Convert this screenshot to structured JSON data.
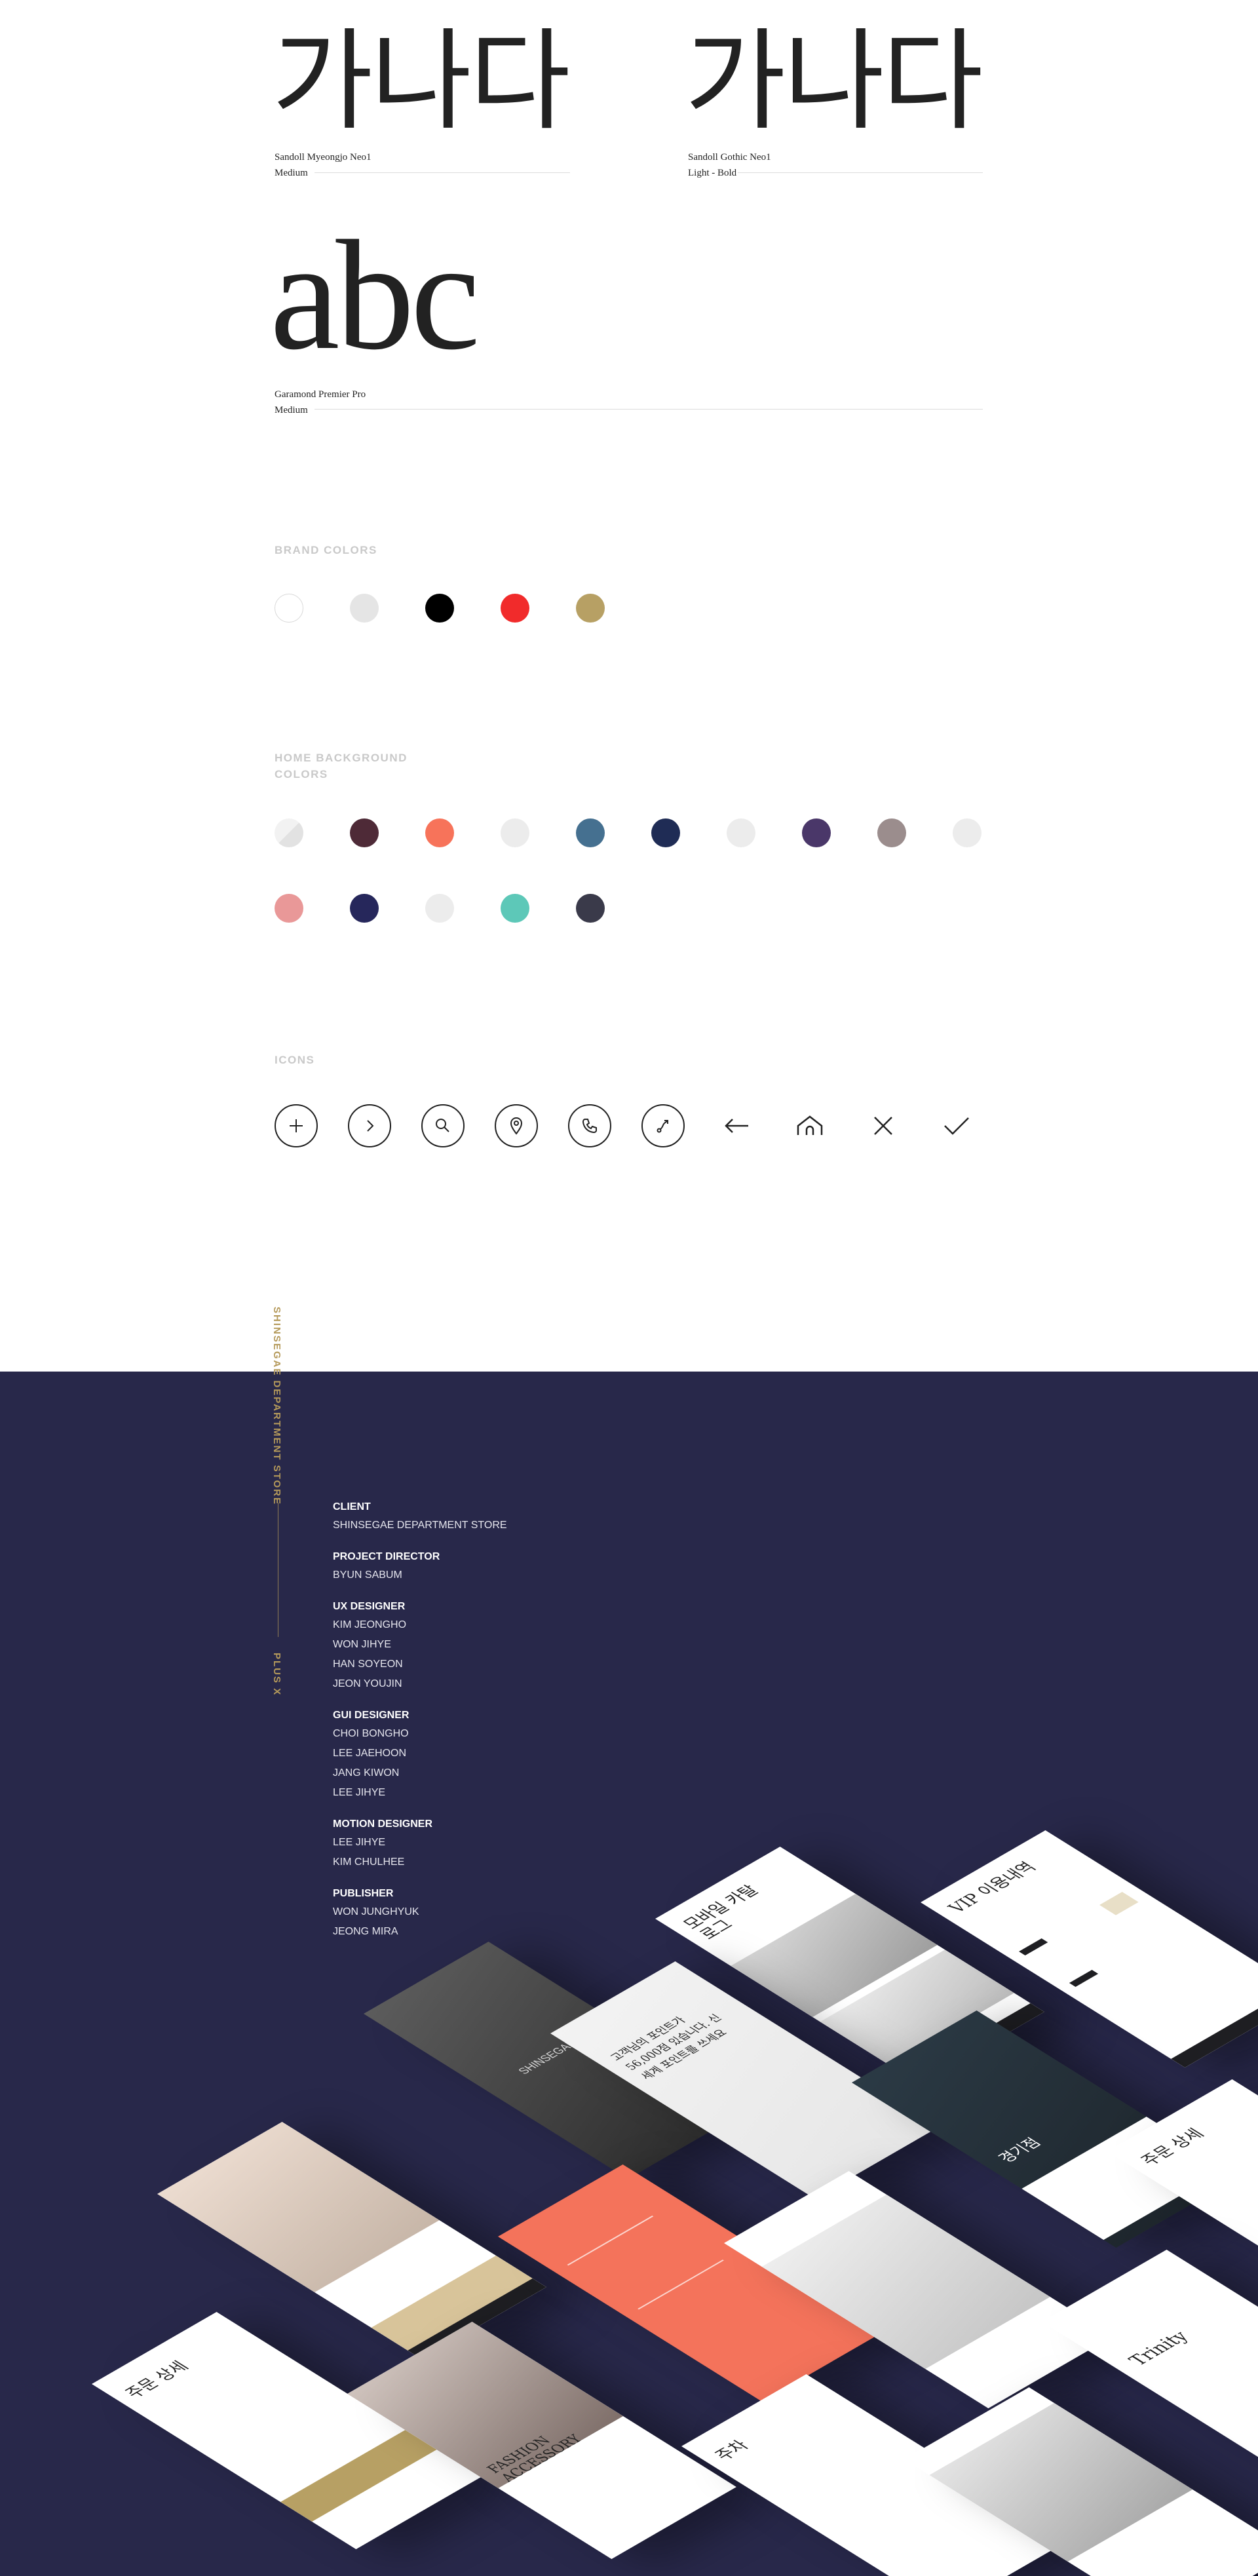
{
  "typography": [
    {
      "sample": "가나다",
      "name": "Sandoll Myeongjo Neo1",
      "weight": "Medium"
    },
    {
      "sample": "가나다",
      "name": "Sandoll Gothic Neo1",
      "weight": "Light - Bold"
    },
    {
      "sample": "abc",
      "name": "Garamond Premier Pro",
      "weight": "Medium"
    }
  ],
  "brand_colors": {
    "title": "BRAND COLORS",
    "colors": [
      "#ffffff",
      "#e5e5e5",
      "#000000",
      "#f12b2b",
      "#b7a064"
    ]
  },
  "home_background_colors": {
    "title_line1": "HOME BACKGROUND",
    "title_line2": "COLORS",
    "row1": [
      "#ececec",
      "#4e2a37",
      "#f7735a",
      "#ececec",
      "#457090",
      "#1f2c55",
      "#ececec",
      "#4a3769",
      "#9b8d8d",
      "#ececec"
    ],
    "row2": [
      "#e99898",
      "#26275b",
      "#ececec",
      "#5dc8b8",
      "#3a3a4a"
    ]
  },
  "icons": {
    "title": "ICONS",
    "items": [
      "plus-icon",
      "chevron-right-icon",
      "search-icon",
      "location-pin-icon",
      "phone-icon",
      "route-icon",
      "arrow-left-icon",
      "home-icon",
      "close-icon",
      "check-icon"
    ]
  },
  "credits": {
    "vertical_store": "SHINSEGAE DEPARTMENT STORE",
    "vertical_agency": "PLUS X",
    "groups": [
      {
        "role": "CLIENT",
        "names": [
          "SHINSEGAE DEPARTMENT STORE"
        ]
      },
      {
        "role": "PROJECT DIRECTOR",
        "names": [
          "BYUN SABUM"
        ]
      },
      {
        "role": "UX DESIGNER",
        "names": [
          "KIM JEONGHO",
          "WON JIHYE",
          "HAN SOYEON",
          "JEON YOUJIN"
        ]
      },
      {
        "role": "GUI DESIGNER",
        "names": [
          "CHOI BONGHO",
          "LEE JAEHOON",
          "JANG KIWON",
          "LEE JIHYE"
        ]
      },
      {
        "role": "MOTION DESIGNER",
        "names": [
          "LEE JIHYE",
          "KIM CHULHEE"
        ]
      },
      {
        "role": "PUBLISHER",
        "names": [
          "WON JUNGHYUK",
          "JEONG MIRA"
        ]
      }
    ]
  },
  "mockups": {
    "splash_logo": "SHINSEGAE",
    "catalog_title": "모바일 카탈로그",
    "vip_title": "VIP 이용내역",
    "order_title": "주문 상세",
    "order_title_2": "주문 상세",
    "gift_title": "주차",
    "trinity_title": "Trinity",
    "fashion_title": "FASHION ACCESSORY",
    "gyeonggi_title": "경기점",
    "coupon_text": "고객님의 포인트가 56,000점 있습니다. 신세계 포인트를 쓰세요"
  }
}
